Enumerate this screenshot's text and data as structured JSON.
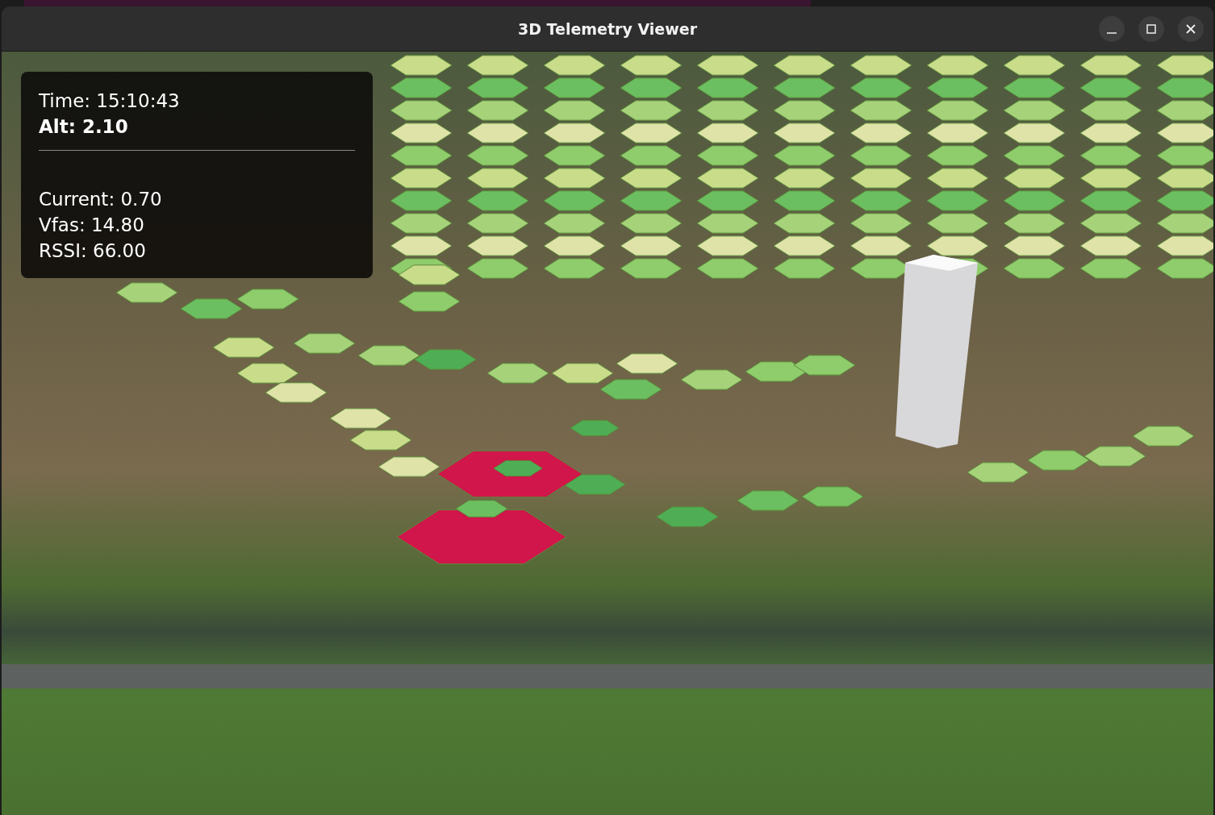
{
  "window": {
    "title": "3D Telemetry Viewer"
  },
  "overlay": {
    "time": "Time: 15:10:43",
    "altitude": "Alt: 2.10",
    "readings": [
      "Current: 0.70",
      "Vfas: 14.80",
      "RSSI: 66.00"
    ]
  }
}
